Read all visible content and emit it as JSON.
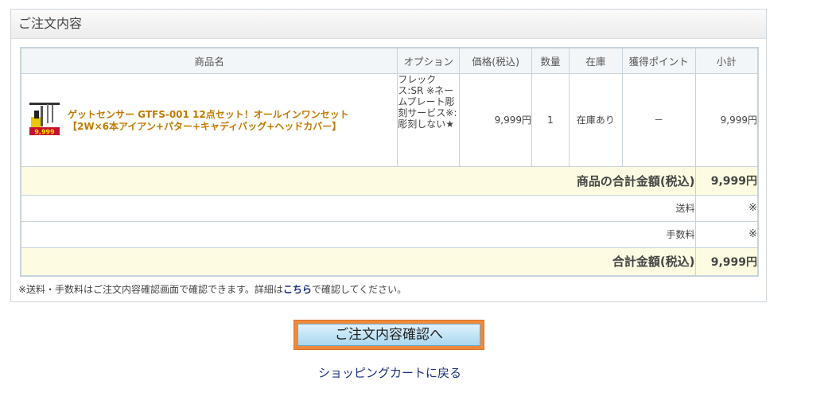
{
  "panel": {
    "title": "ご注文内容"
  },
  "table": {
    "headers": [
      "商品名",
      "オプション",
      "価格(税込)",
      "数量",
      "在庫",
      "獲得ポイント",
      "小計"
    ],
    "item": {
      "name": "ゲットセンサー GTFS-001 12点セット！オールインワンセット【2W×6本アイアン+パター+キャディバッグ+ヘッドカバー】",
      "option": "フレックス:SR ※ネームプレート彫刻サービス※:彫刻しない★",
      "price": "9,999円",
      "qty": "1",
      "stock": "在庫あり",
      "points": "－",
      "subtotal": "9,999円",
      "thumbnail_text": "9,999"
    },
    "product_total_label": "商品の合計金額(税込)",
    "product_total_value": "9,999円",
    "shipping_label": "送料",
    "shipping_value": "※",
    "fee_label": "手数料",
    "fee_value": "※",
    "grand_total_label": "合計金額(税込)",
    "grand_total_value": "9,999円"
  },
  "note": {
    "prefix": "※送料・手数料はご注文内容確認画面で確認できます。詳細は",
    "link": "こちら",
    "suffix": "で確認してください。"
  },
  "actions": {
    "confirm_label": "ご注文内容確認へ",
    "back_label": "ショッピングカートに戻る"
  },
  "colors": {
    "accent_orange": "#f0893a",
    "link_blue": "#1b2f7a",
    "product_link": "#c27a00",
    "total_bg": "#fdfce3"
  }
}
